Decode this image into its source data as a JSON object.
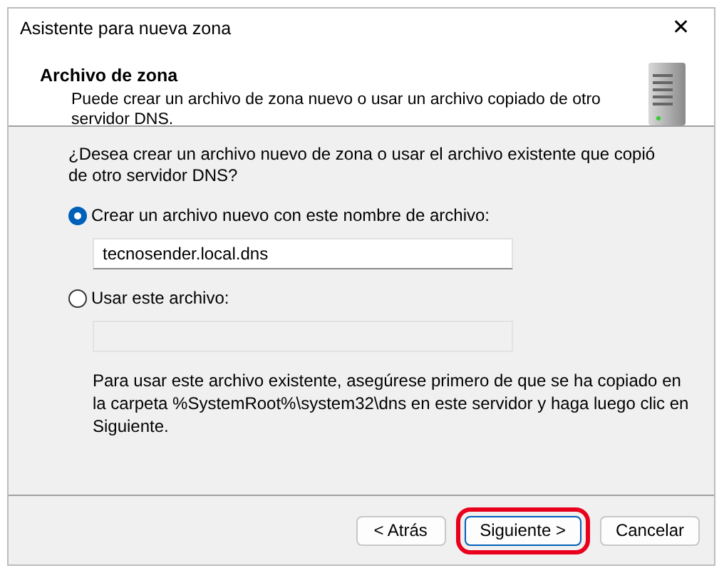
{
  "window": {
    "title": "Asistente para nueva zona",
    "close": "✕"
  },
  "header": {
    "title": "Archivo de zona",
    "subtitle": "Puede crear un archivo de zona nuevo o usar un archivo copiado de otro servidor DNS."
  },
  "question": "¿Desea crear un archivo nuevo de zona o usar el archivo existente que copió de otro servidor DNS?",
  "options": [
    {
      "label": "Crear un archivo nuevo con este nombre de archivo:",
      "selected": true,
      "value": "tecnosender.local.dns"
    },
    {
      "label": "Usar este archivo:",
      "selected": false
    }
  ],
  "note": "Para usar este archivo existente, asegúrese primero de que se ha copiado en la carpeta %SystemRoot%\\system32\\dns en este servidor y haga luego clic en Siguiente.",
  "buttons": [
    {
      "label": "< Atrás",
      "highlighted": false
    },
    {
      "label": "Siguiente >",
      "highlighted": true
    },
    {
      "label": "Cancelar",
      "highlighted": false
    }
  ]
}
